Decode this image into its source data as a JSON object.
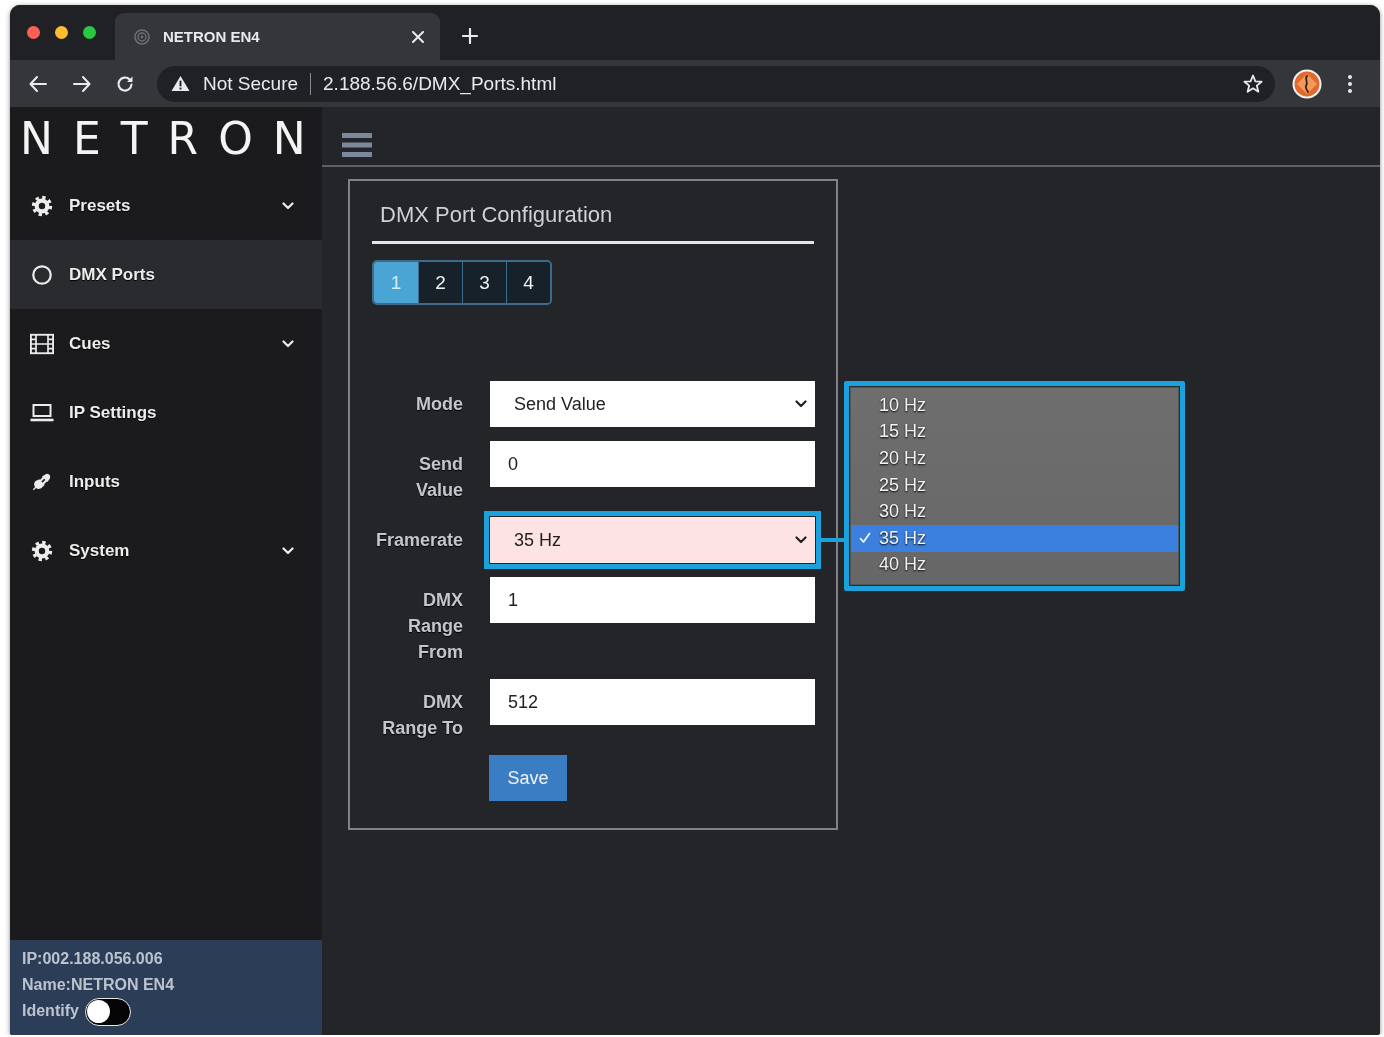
{
  "browser": {
    "tab_title": "NETRON EN4",
    "security": "Not Secure",
    "url": "2.188.56.6/DMX_Ports.html"
  },
  "logo": "NETRON",
  "sidebar": {
    "items": [
      {
        "label": "Presets",
        "expandable": true,
        "selected": false
      },
      {
        "label": "DMX Ports",
        "expandable": false,
        "selected": true
      },
      {
        "label": "Cues",
        "expandable": true,
        "selected": false
      },
      {
        "label": "IP Settings",
        "expandable": false,
        "selected": false
      },
      {
        "label": "Inputs",
        "expandable": false,
        "selected": false
      },
      {
        "label": "System",
        "expandable": true,
        "selected": false
      }
    ],
    "footer": {
      "ip": "IP:002.188.056.006",
      "name": "Name:NETRON EN4",
      "identify": {
        "label": "Identify",
        "on": false
      }
    }
  },
  "panel": {
    "title": "DMX Port Configuration",
    "port_tabs": [
      {
        "label": "1",
        "selected": true
      },
      {
        "label": "2",
        "selected": false
      },
      {
        "label": "3",
        "selected": false
      },
      {
        "label": "4",
        "selected": false
      }
    ],
    "fields": [
      {
        "kind": "select",
        "label": "Mode",
        "value": "Send Value",
        "focused": false
      },
      {
        "kind": "input",
        "label": "Send Value",
        "value": "0",
        "focused": false
      },
      {
        "kind": "select",
        "label": "Framerate",
        "value": "35 Hz",
        "focused": true,
        "expanded": true,
        "options": [
          {
            "label": "10 Hz",
            "selected": false
          },
          {
            "label": "15 Hz",
            "selected": false
          },
          {
            "label": "20 Hz",
            "selected": false
          },
          {
            "label": "25 Hz",
            "selected": false
          },
          {
            "label": "30 Hz",
            "selected": false
          },
          {
            "label": "35 Hz",
            "selected": true
          },
          {
            "label": "40 Hz",
            "selected": false
          }
        ]
      },
      {
        "kind": "input",
        "label": "DMX Range From",
        "value": "1",
        "focused": false
      },
      {
        "kind": "input",
        "label": "DMX Range To",
        "value": "512",
        "focused": false
      }
    ],
    "save_button": "Save"
  }
}
